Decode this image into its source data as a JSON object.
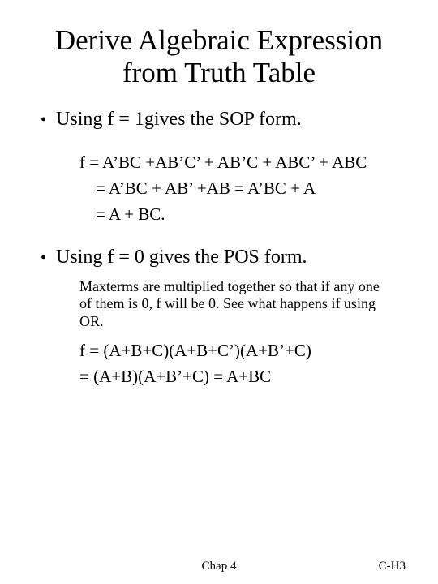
{
  "title": "Derive Algebraic Expression from Truth Table",
  "bullets": [
    {
      "text": "Using f = 1gives the SOP form."
    },
    {
      "text": "Using f = 0 gives the POS form."
    }
  ],
  "sop": {
    "line1": "f = A’BC +AB’C’ + AB’C + ABC’ + ABC",
    "line2": "= A’BC + AB’ +AB = A’BC + A",
    "line3": "= A + BC."
  },
  "pos": {
    "note": "Maxterms are multiplied together so that if any one of them is 0, f will be 0. See what happens if using OR.",
    "line1": "f = (A+B+C)(A+B+C’)(A+B’+C)",
    "line2": "= (A+B)(A+B’+C) = A+BC"
  },
  "footer": {
    "center": "Chap 4",
    "right": "C-H3"
  }
}
